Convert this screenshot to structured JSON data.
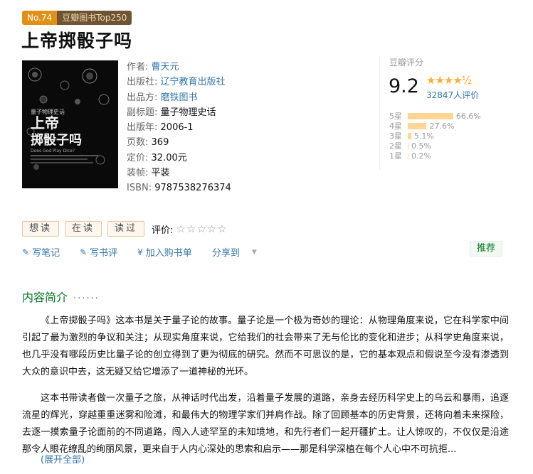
{
  "badges": {
    "rank": "No.74",
    "list": "豆瓣图书Top250"
  },
  "book": {
    "title": "上帝掷骰子吗",
    "cover_title": "上帝掷骰子吗",
    "cover_series": "量子物理史话",
    "cover_en": "Does God Play Dice?"
  },
  "info": {
    "author_k": "作者:",
    "author": "曹天元",
    "publisher_k": "出版社:",
    "publisher": "辽宁教育出版社",
    "producer_k": "出品方:",
    "producer": "磨铁图书",
    "subtitle_k": "副标题:",
    "subtitle": "量子物理史话",
    "year_k": "出版年:",
    "year": "2006-1",
    "pages_k": "页数:",
    "pages": "369",
    "price_k": "定价:",
    "price": "32.00元",
    "binding_k": "装帧:",
    "binding": "平装",
    "isbn_k": "ISBN:",
    "isbn": "9787538276374"
  },
  "rating": {
    "label": "豆瓣评分",
    "score": "9.2",
    "stars": "★★★★½",
    "count": "32847人评价",
    "distribution": [
      {
        "label": "5星",
        "pct": "66.6%",
        "value": 66.6
      },
      {
        "label": "4星",
        "pct": "27.6%",
        "value": 27.6
      },
      {
        "label": "3星",
        "pct": "5.1%",
        "value": 5.1
      },
      {
        "label": "2星",
        "pct": "0.5%",
        "value": 0.5
      },
      {
        "label": "1星",
        "pct": "0.2%",
        "value": 0.2
      }
    ]
  },
  "actions": {
    "want": "想读",
    "reading": "在读",
    "read": "读过",
    "rate_label": "评价:",
    "rate_stars": "☆☆☆☆☆"
  },
  "ops": {
    "note": "写笔记",
    "review": "写书评",
    "cart": "加入购书单",
    "share": "分享到",
    "recommend": "推荐"
  },
  "section": {
    "title": "内容简介",
    "dots": "······"
  },
  "intro": {
    "p1": "《上帝掷骰子吗》这本书是关于量子论的故事。量子论是一个极为奇妙的理论：从物理角度来说，它在科学家中间引起了最为激烈的争议和关注；从现实角度来说，它给我们的社会带来了无与伦比的变化和进步；从科学史角度来说，也几乎没有哪段历史比量子论的创立得到了更为彻底的研究。然而不可思议的是，它的基本观点和假说至今没有渗透到大众的意识中去，这无疑又给它增添了一道神秘的光环。",
    "p2": "这本书带读者做一次量子之旅，从神话时代出发，沿着量子发展的道路，亲身去经历科学史上的乌云和暴雨，追逐流星的辉光，穿越重重迷雾和险滩，和最伟大的物理学家们并肩作战。除了回顾基本的历史背景，还将向着未来探险，去逐一摸索量子论面前的不同道路，闯入人迹罕至的未知境地，和先行者们一起开疆扩土。让人惊叹的，不仅仅是沿途那令人眼花缭乱的绚丽风景，更来自于人内心深处的思索和启示——那是科学深植在每个人心中不可抗拒...",
    "more": "(展开全部)"
  }
}
